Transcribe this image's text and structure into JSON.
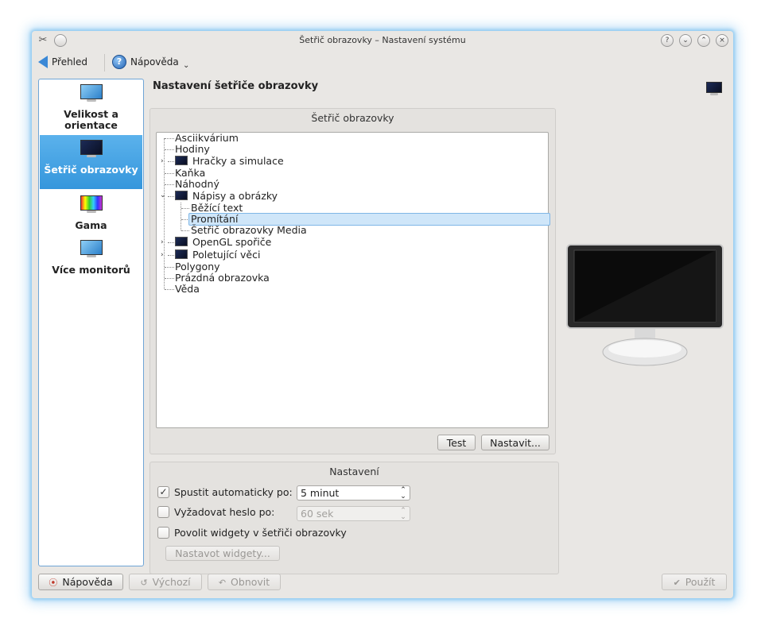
{
  "window": {
    "title": "Šetřič obrazovky – Nastavení systému",
    "titlebar_buttons": [
      "?",
      "⌄",
      "⌃",
      "×"
    ]
  },
  "toolbar": {
    "overview_label": "Přehled",
    "help_label": "Nápověda"
  },
  "sidebar": {
    "items": [
      {
        "label": "Velikost a orientace",
        "selected": false,
        "icon": "monitor-icon"
      },
      {
        "label": "Šetřič obrazovky",
        "selected": true,
        "icon": "screensaver-icon"
      },
      {
        "label": "Gama",
        "selected": false,
        "icon": "gamma-icon"
      },
      {
        "label": "Více monitorů",
        "selected": false,
        "icon": "monitor-icon"
      }
    ]
  },
  "main": {
    "heading": "Nastavení šetřiče obrazovky",
    "saver_group": {
      "title": "Šetřič obrazovky",
      "tree": [
        {
          "label": "Asciikvárium"
        },
        {
          "label": "Hodiny"
        },
        {
          "label": "Hračky a simulace",
          "expandable": true,
          "expanded": false
        },
        {
          "label": "Kaňka"
        },
        {
          "label": "Náhodný"
        },
        {
          "label": "Nápisy a obrázky",
          "expandable": true,
          "expanded": true
        },
        {
          "label": "Běžící text",
          "child": true
        },
        {
          "label": "Promítání",
          "child": true,
          "selected": true
        },
        {
          "label": "Šetřič obrazovky Media",
          "child": true
        },
        {
          "label": "OpenGL spořiče",
          "expandable": true,
          "expanded": false
        },
        {
          "label": "Poletující věci",
          "expandable": true,
          "expanded": false
        },
        {
          "label": "Polygony"
        },
        {
          "label": "Prázdná obrazovka"
        },
        {
          "label": "Věda"
        }
      ],
      "test_button": "Test",
      "setup_button": "Nastavit..."
    },
    "settings_group": {
      "title": "Nastavení",
      "auto_start": {
        "label": "Spustit automaticky po:",
        "checked": true,
        "value": "5 minut"
      },
      "require_password": {
        "label": "Vyžadovat heslo po:",
        "checked": false,
        "value": "60 sek"
      },
      "allow_widgets": {
        "label": "Povolit widgety v šetřiči obrazovky",
        "checked": false
      },
      "widgets_button": "Nastavot widgety..."
    }
  },
  "footer": {
    "help_button": "Nápověda",
    "defaults_button": "Výchozí",
    "reset_button": "Obnovit",
    "apply_button": "Použít"
  }
}
